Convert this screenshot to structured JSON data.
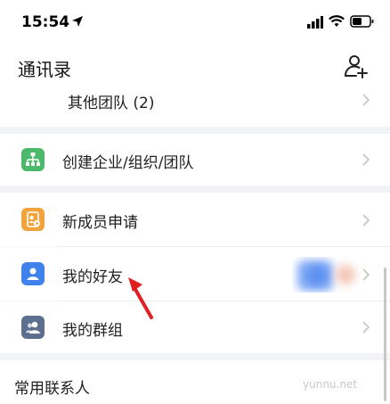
{
  "status_bar": {
    "time": "15:54"
  },
  "header": {
    "title": "通讯录"
  },
  "rows": {
    "other_teams": "其他团队 (2)",
    "create_org": "创建企业/组织/团队",
    "new_members": "新成员申请",
    "my_friends": "我的好友",
    "my_groups": "我的群组"
  },
  "section": {
    "frequent_contacts": "常用联系人"
  },
  "watermark": "yunnu.net",
  "colors": {
    "create_org_icon": "#4cb86a",
    "new_members_icon": "#f2a33b",
    "my_friends_icon": "#3f82ec",
    "my_groups_icon": "#5c6f8f",
    "annotation_arrow": "#e02020"
  }
}
